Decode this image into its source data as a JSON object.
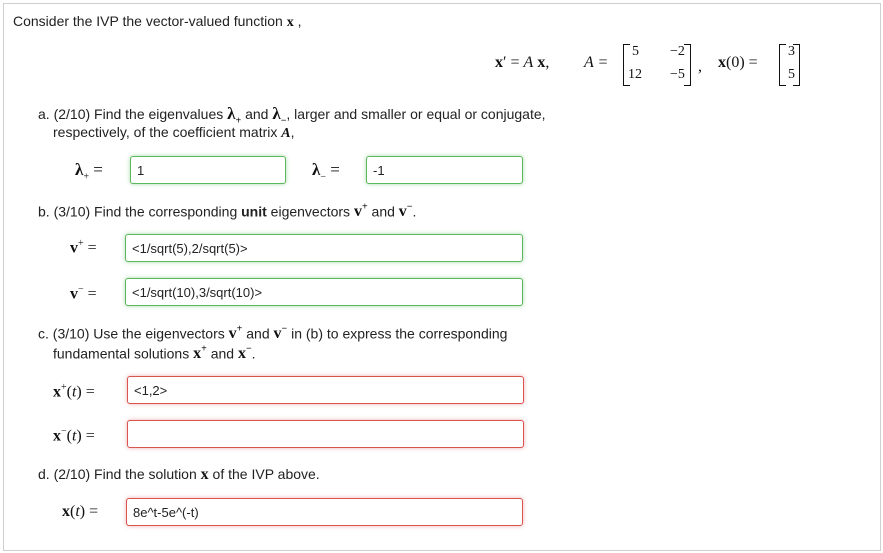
{
  "intro": "Consider the IVP the vector-valued function",
  "intro_var": "x",
  "eq": {
    "lhs": "x′ = A x,",
    "A_label": "A =",
    "A": [
      "5",
      "−2",
      "12",
      "−5"
    ],
    "x0_label": "x(0) =",
    "x0": [
      "3",
      "5"
    ]
  },
  "part_a": {
    "line1": "a. (2/10) Find the eigenvalues",
    "and": "and",
    "rest1": ", larger and smaller or equal or conjugate,",
    "line2": "respectively, of the coefficient matrix",
    "matrix_var": "A",
    "lambda_plus_label": "λ+ =",
    "lambda_minus_label": "λ− =",
    "lambda_plus_value": "1",
    "lambda_minus_value": "-1"
  },
  "part_b": {
    "prefix": "b. (3/10) Find the corresponding",
    "unit": "unit",
    "suffix": "eigenvectors",
    "and": "and",
    "v_plus_label": "v+ =",
    "v_minus_label": "v− =",
    "v_plus_value": "<1/sqrt(5),2/sqrt(5)>",
    "v_minus_value": "<1/sqrt(10),3/sqrt(10)>"
  },
  "part_c": {
    "line1": "c. (3/10) Use the eigenvectors",
    "and": "and",
    "line1_end": "in (b) to express the corresponding",
    "line2": "fundamental solutions",
    "x_plus_label": "x+(t) =",
    "x_minus_label": "x−(t) =",
    "x_plus_value": "<1,2>",
    "x_minus_value": ""
  },
  "part_d": {
    "text": "d. (2/10) Find the solution",
    "text_end": "of the IVP above.",
    "x_label": "x(t) =",
    "x_value": "8e^t-5e^(-t)"
  }
}
